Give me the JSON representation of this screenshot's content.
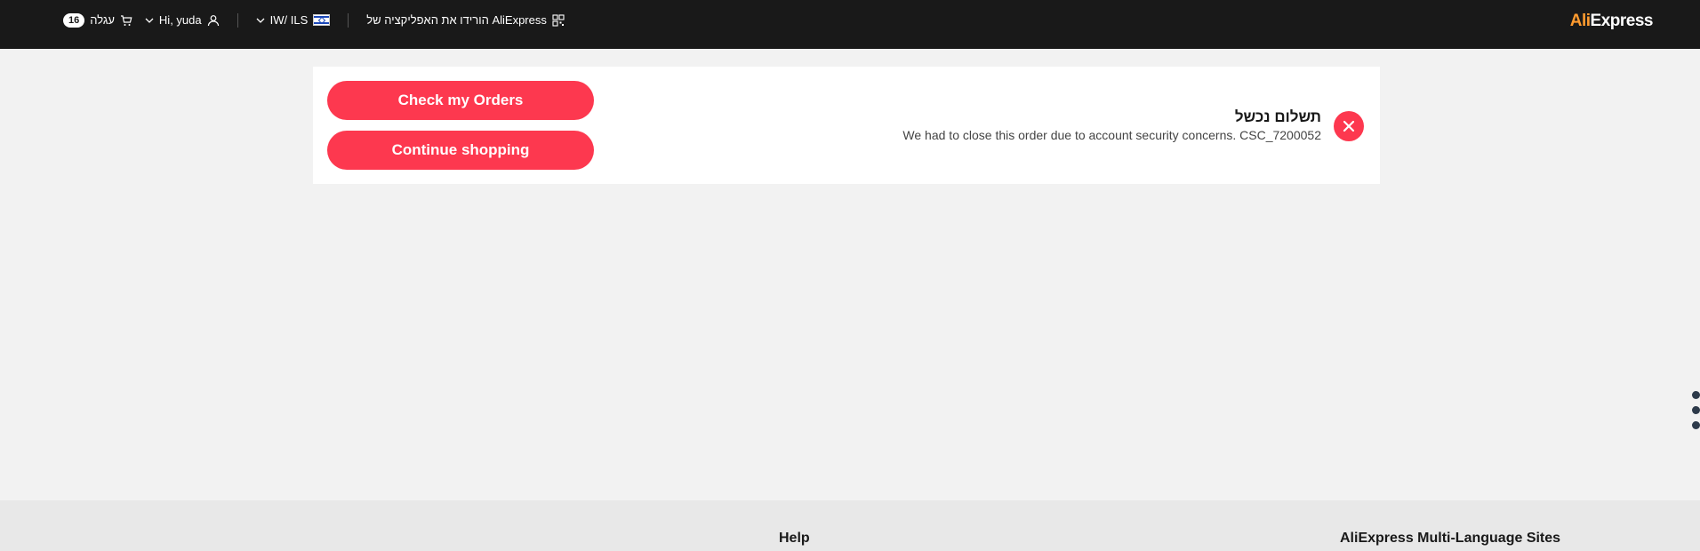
{
  "header": {
    "cart_label": "עגלה",
    "cart_count": "16",
    "greeting": "Hi, yuda",
    "lang_currency": "IW/ ILS",
    "app_download": "הורידו את האפליקציה של AliExpress",
    "logo_ali": "Ali",
    "logo_express": "Express"
  },
  "main": {
    "check_orders_label": "Check my Orders",
    "continue_shopping_label": "Continue shopping",
    "status_title": "תשלום נכשל",
    "status_message": "We had to close this order due to account security concerns. CSC_7200052"
  },
  "footer": {
    "help_title": "Help",
    "multi_lang_title": "AliExpress Multi-Language Sites"
  },
  "colors": {
    "accent": "#fd384f",
    "topbar": "#191919",
    "page_bg": "#f2f2f2"
  }
}
